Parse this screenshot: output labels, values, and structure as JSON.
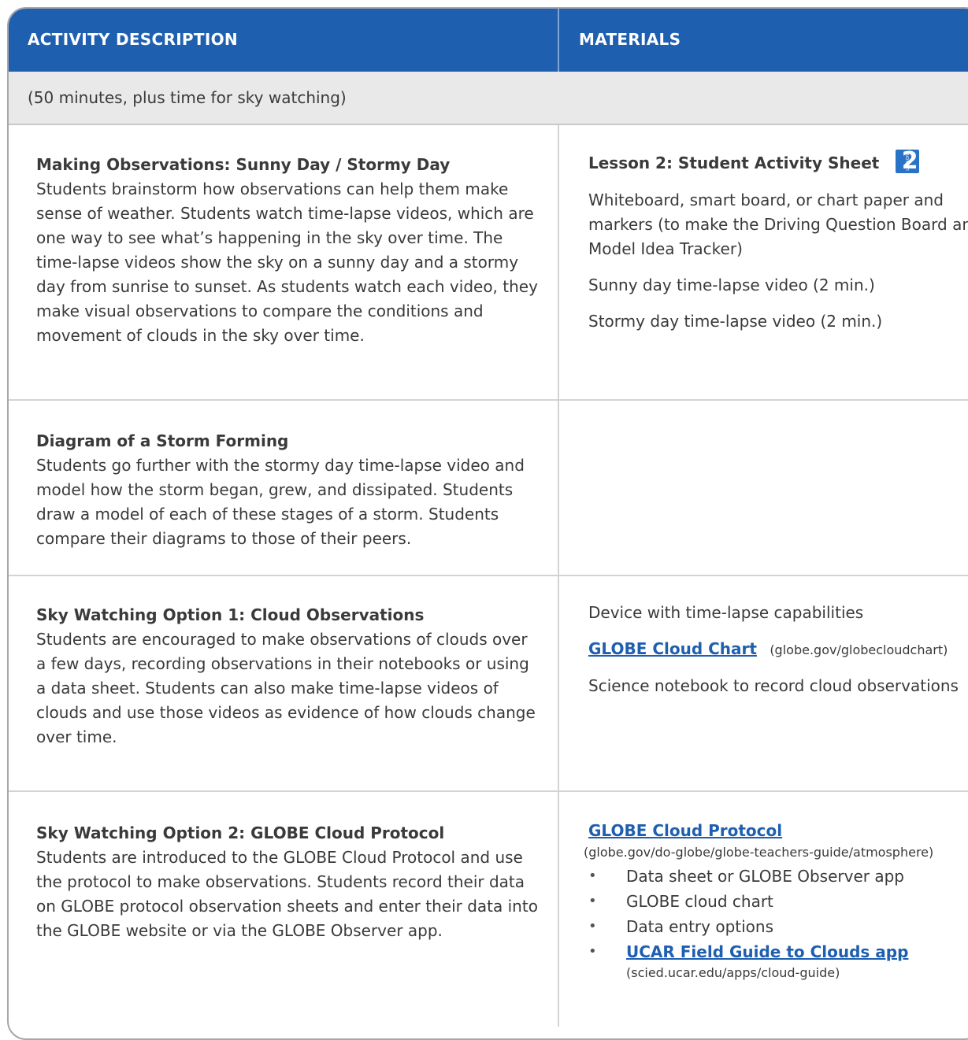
{
  "header": {
    "activity_description": "ACTIVITY DESCRIPTION",
    "materials": "MATERIALS"
  },
  "duration": "(50 minutes, plus time for sky watching)",
  "rows": [
    {
      "title": "Making Observations: Sunny Day / Stormy Day",
      "body": "Students brainstorm how observations can help them make sense of weather. Students watch time-lapse videos, which are one way to see what’s happening in the sky over time. The time-lapse videos show the sky on a sunny day and a stormy day from sunrise to sunset. As students watch each video, they make visual observations to compare the conditions and movement of clouds in the sky over time.",
      "materials": {
        "activity_sheet": "Lesson 2: Student Activity Sheet",
        "badge_label": "LESSON",
        "badge_number": "2",
        "items": [
          "Whiteboard, smart board, or chart paper and markers (to make the Driving Question Board and Model Idea Tracker)",
          "Sunny day time-lapse video (2 min.)",
          "Stormy day time-lapse video (2 min.)"
        ]
      }
    },
    {
      "title": "Diagram of a Storm Forming",
      "body": "Students go further with the stormy day time-lapse video and model how the storm began, grew, and dissipated. Students draw a model of each of these stages of a storm. Students compare their diagrams to those of their peers."
    },
    {
      "title": "Sky Watching Option 1: Cloud Observations",
      "body": "Students are encouraged to make observations of clouds over a few days, recording observations in their notebooks or using a data sheet. Students can also make time-lapse videos of clouds and use those videos as evidence of how clouds change over time.",
      "materials": {
        "device": "Device with time-lapse capabilities",
        "link_label": "GLOBE Cloud Chart",
        "link_url_text": "(globe.gov/globecloudchart)",
        "notebook": "Science notebook to record cloud observations"
      }
    },
    {
      "title": "Sky Watching Option 2: GLOBE Cloud Protocol",
      "body": "Students are introduced to the GLOBE Cloud Protocol and use the protocol to make observations. Students record their data on GLOBE protocol observation sheets and enter their data into the GLOBE website or via the GLOBE Observer app.",
      "materials": {
        "link_label": "GLOBE Cloud Protocol",
        "link_url_text": "(globe.gov/do-globe/globe-teachers-guide/atmosphere)",
        "bullets": [
          "Data sheet or GLOBE Observer app",
          "GLOBE cloud chart",
          "Data entry options"
        ],
        "ucar_link_label": "UCAR Field Guide to Clouds app",
        "ucar_url_text": "(scied.ucar.edu/apps/cloud-guide)"
      }
    }
  ],
  "colors": {
    "header_blue": "#1e5fb0",
    "link_blue": "#1e5fb0",
    "badge_blue": "#2a72c6",
    "duration_bg": "#e9e9e9"
  }
}
